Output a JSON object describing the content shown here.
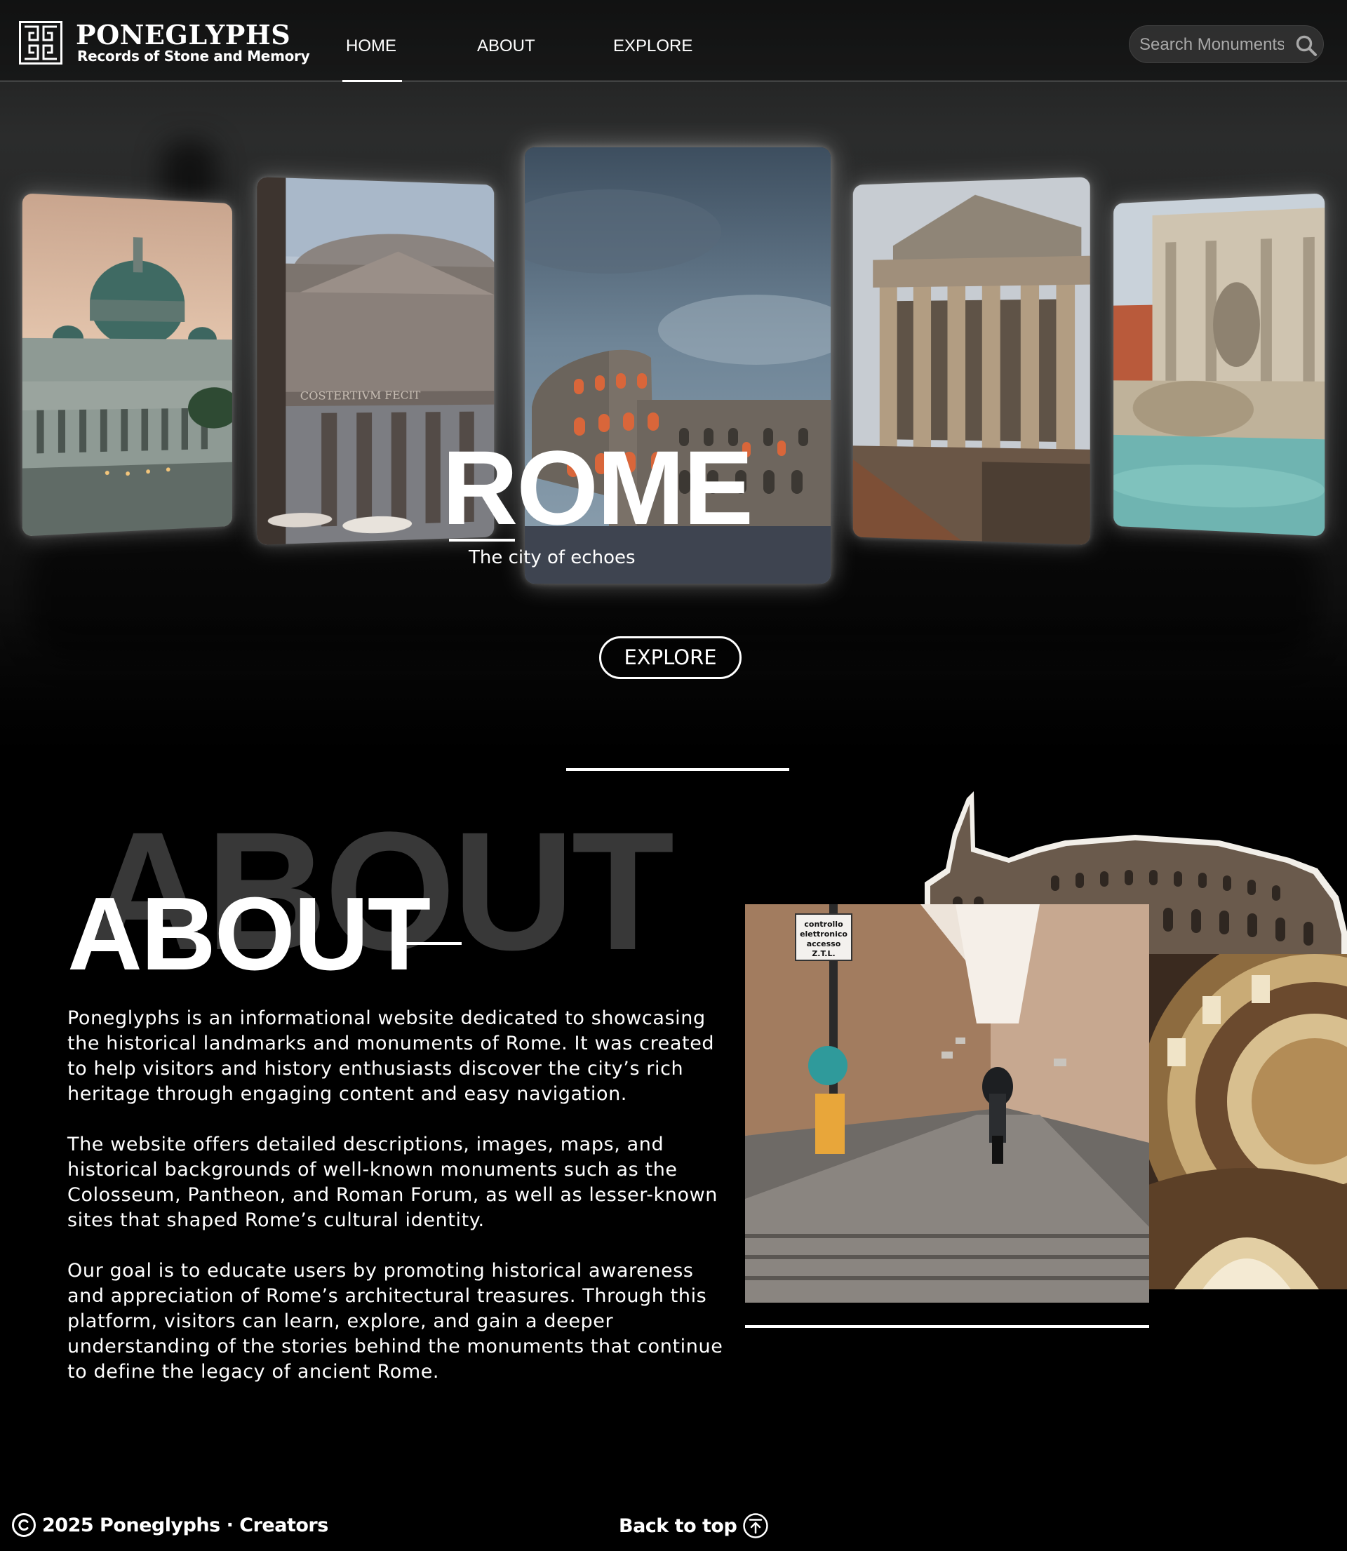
{
  "brand": {
    "name": "PONEGLYPHS",
    "tagline": "Records of Stone and Memory",
    "logo_icon": "glyph-logo-icon"
  },
  "nav": {
    "items": [
      {
        "label": "HOME",
        "active": true
      },
      {
        "label": "ABOUT",
        "active": false
      },
      {
        "label": "EXPLORE",
        "active": false
      }
    ]
  },
  "search": {
    "placeholder": "Search Monuments",
    "value": "",
    "icon": "search-icon"
  },
  "hero": {
    "title": "ROME",
    "subtitle": "The city of echoes",
    "cta_label": "EXPLORE",
    "cards": [
      {
        "subject": "St. Peter's Basilica"
      },
      {
        "subject": "Pantheon",
        "inscription": "COSTERTIVM FECIT"
      },
      {
        "subject": "Colosseum",
        "featured": true
      },
      {
        "subject": "Temple of Antoninus and Faustina"
      },
      {
        "subject": "Trevi Fountain"
      }
    ]
  },
  "about": {
    "ghost_title": "ABOUT",
    "title": "ABOUT",
    "paragraphs": [
      "Poneglyphs is an informational website dedicated to showcasing the historical landmarks and monuments of Rome. It was created to help visitors and history enthusiasts discover the city’s rich heritage through engaging content and easy navigation.",
      "The website offers detailed descriptions, images, maps, and historical backgrounds of well-known monuments such as the Colosseum, Pantheon, and Roman Forum, as well as lesser-known sites that shaped Rome’s cultural identity.",
      "Our goal is to educate users by promoting historical awareness and appreciation of Rome’s architectural treasures. Through this platform, visitors can learn, explore, and gain a deeper understanding of the stories behind the monuments that continue to define the legacy of ancient Rome."
    ],
    "street_sign": [
      "controllo",
      "elettronico",
      "accesso",
      "Z.T.L."
    ]
  },
  "footer": {
    "copyright": "2025 Poneglyphs · Creators",
    "back_to_top": "Back to top"
  },
  "colors": {
    "background": "#000000",
    "text": "#ffffff",
    "ghost_text": "#383838",
    "search_bg": "#3a3a3a"
  }
}
